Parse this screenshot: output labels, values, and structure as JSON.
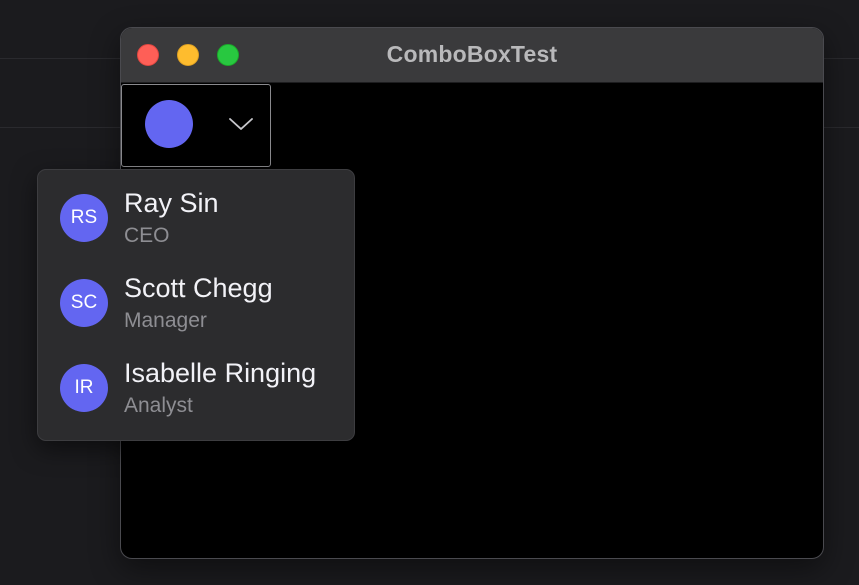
{
  "window": {
    "title": "ComboBoxTest"
  },
  "combobox": {
    "selected_color": "#6366f1"
  },
  "dropdown": {
    "options": [
      {
        "initials": "RS",
        "name": "Ray Sin",
        "role": "CEO"
      },
      {
        "initials": "SC",
        "name": "Scott Chegg",
        "role": "Manager"
      },
      {
        "initials": "IR",
        "name": "Isabelle Ringing",
        "role": "Analyst"
      }
    ]
  },
  "colors": {
    "accent": "#6366f1",
    "traffic_close": "#fe5f57",
    "traffic_minimize": "#febc2e",
    "traffic_zoom": "#28c840"
  }
}
